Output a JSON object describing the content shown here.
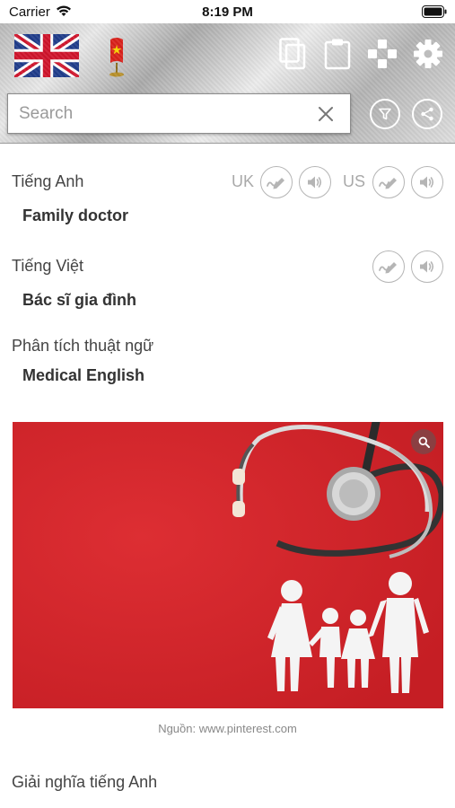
{
  "status_bar": {
    "carrier": "Carrier",
    "time": "8:19 PM"
  },
  "header": {
    "search": {
      "placeholder": "Search",
      "value": ""
    },
    "icons": [
      "uk-flag-icon",
      "vietnam-flag-icon",
      "copy-icon",
      "clipboard-icon",
      "gamepad-icon",
      "gear-icon",
      "filter-icon",
      "share-icon"
    ]
  },
  "english": {
    "label": "Tiếng Anh",
    "term": "Family doctor",
    "uk_label": "UK",
    "us_label": "US"
  },
  "vietnamese": {
    "label": "Tiếng Việt",
    "term": "Bác sĩ gia đình"
  },
  "analysis": {
    "label": "Phân tích thuật ngữ",
    "value": "Medical English"
  },
  "image": {
    "caption": "Nguồn: www.pinterest.com",
    "background": "#d5242a"
  },
  "definition": {
    "label": "Giải nghĩa tiếng Anh"
  },
  "colors": {
    "accent_red": "#d5242a",
    "header_silver": "#c9c9c9",
    "muted": "#a9a9a9"
  }
}
